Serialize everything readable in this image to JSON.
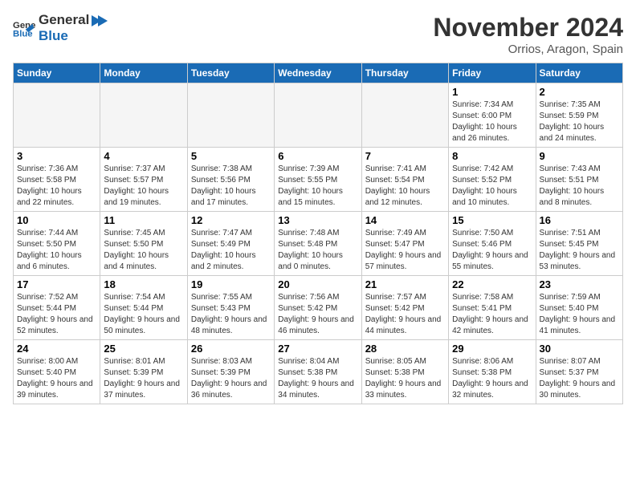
{
  "header": {
    "logo_general": "General",
    "logo_blue": "Blue",
    "month_title": "November 2024",
    "subtitle": "Orrios, Aragon, Spain"
  },
  "weekdays": [
    "Sunday",
    "Monday",
    "Tuesday",
    "Wednesday",
    "Thursday",
    "Friday",
    "Saturday"
  ],
  "weeks": [
    [
      {
        "day": "",
        "empty": true
      },
      {
        "day": "",
        "empty": true
      },
      {
        "day": "",
        "empty": true
      },
      {
        "day": "",
        "empty": true
      },
      {
        "day": "",
        "empty": true
      },
      {
        "day": "1",
        "sunrise": "Sunrise: 7:34 AM",
        "sunset": "Sunset: 6:00 PM",
        "daylight": "Daylight: 10 hours and 26 minutes."
      },
      {
        "day": "2",
        "sunrise": "Sunrise: 7:35 AM",
        "sunset": "Sunset: 5:59 PM",
        "daylight": "Daylight: 10 hours and 24 minutes."
      }
    ],
    [
      {
        "day": "3",
        "sunrise": "Sunrise: 7:36 AM",
        "sunset": "Sunset: 5:58 PM",
        "daylight": "Daylight: 10 hours and 22 minutes."
      },
      {
        "day": "4",
        "sunrise": "Sunrise: 7:37 AM",
        "sunset": "Sunset: 5:57 PM",
        "daylight": "Daylight: 10 hours and 19 minutes."
      },
      {
        "day": "5",
        "sunrise": "Sunrise: 7:38 AM",
        "sunset": "Sunset: 5:56 PM",
        "daylight": "Daylight: 10 hours and 17 minutes."
      },
      {
        "day": "6",
        "sunrise": "Sunrise: 7:39 AM",
        "sunset": "Sunset: 5:55 PM",
        "daylight": "Daylight: 10 hours and 15 minutes."
      },
      {
        "day": "7",
        "sunrise": "Sunrise: 7:41 AM",
        "sunset": "Sunset: 5:54 PM",
        "daylight": "Daylight: 10 hours and 12 minutes."
      },
      {
        "day": "8",
        "sunrise": "Sunrise: 7:42 AM",
        "sunset": "Sunset: 5:52 PM",
        "daylight": "Daylight: 10 hours and 10 minutes."
      },
      {
        "day": "9",
        "sunrise": "Sunrise: 7:43 AM",
        "sunset": "Sunset: 5:51 PM",
        "daylight": "Daylight: 10 hours and 8 minutes."
      }
    ],
    [
      {
        "day": "10",
        "sunrise": "Sunrise: 7:44 AM",
        "sunset": "Sunset: 5:50 PM",
        "daylight": "Daylight: 10 hours and 6 minutes."
      },
      {
        "day": "11",
        "sunrise": "Sunrise: 7:45 AM",
        "sunset": "Sunset: 5:50 PM",
        "daylight": "Daylight: 10 hours and 4 minutes."
      },
      {
        "day": "12",
        "sunrise": "Sunrise: 7:47 AM",
        "sunset": "Sunset: 5:49 PM",
        "daylight": "Daylight: 10 hours and 2 minutes."
      },
      {
        "day": "13",
        "sunrise": "Sunrise: 7:48 AM",
        "sunset": "Sunset: 5:48 PM",
        "daylight": "Daylight: 10 hours and 0 minutes."
      },
      {
        "day": "14",
        "sunrise": "Sunrise: 7:49 AM",
        "sunset": "Sunset: 5:47 PM",
        "daylight": "Daylight: 9 hours and 57 minutes."
      },
      {
        "day": "15",
        "sunrise": "Sunrise: 7:50 AM",
        "sunset": "Sunset: 5:46 PM",
        "daylight": "Daylight: 9 hours and 55 minutes."
      },
      {
        "day": "16",
        "sunrise": "Sunrise: 7:51 AM",
        "sunset": "Sunset: 5:45 PM",
        "daylight": "Daylight: 9 hours and 53 minutes."
      }
    ],
    [
      {
        "day": "17",
        "sunrise": "Sunrise: 7:52 AM",
        "sunset": "Sunset: 5:44 PM",
        "daylight": "Daylight: 9 hours and 52 minutes."
      },
      {
        "day": "18",
        "sunrise": "Sunrise: 7:54 AM",
        "sunset": "Sunset: 5:44 PM",
        "daylight": "Daylight: 9 hours and 50 minutes."
      },
      {
        "day": "19",
        "sunrise": "Sunrise: 7:55 AM",
        "sunset": "Sunset: 5:43 PM",
        "daylight": "Daylight: 9 hours and 48 minutes."
      },
      {
        "day": "20",
        "sunrise": "Sunrise: 7:56 AM",
        "sunset": "Sunset: 5:42 PM",
        "daylight": "Daylight: 9 hours and 46 minutes."
      },
      {
        "day": "21",
        "sunrise": "Sunrise: 7:57 AM",
        "sunset": "Sunset: 5:42 PM",
        "daylight": "Daylight: 9 hours and 44 minutes."
      },
      {
        "day": "22",
        "sunrise": "Sunrise: 7:58 AM",
        "sunset": "Sunset: 5:41 PM",
        "daylight": "Daylight: 9 hours and 42 minutes."
      },
      {
        "day": "23",
        "sunrise": "Sunrise: 7:59 AM",
        "sunset": "Sunset: 5:40 PM",
        "daylight": "Daylight: 9 hours and 41 minutes."
      }
    ],
    [
      {
        "day": "24",
        "sunrise": "Sunrise: 8:00 AM",
        "sunset": "Sunset: 5:40 PM",
        "daylight": "Daylight: 9 hours and 39 minutes."
      },
      {
        "day": "25",
        "sunrise": "Sunrise: 8:01 AM",
        "sunset": "Sunset: 5:39 PM",
        "daylight": "Daylight: 9 hours and 37 minutes."
      },
      {
        "day": "26",
        "sunrise": "Sunrise: 8:03 AM",
        "sunset": "Sunset: 5:39 PM",
        "daylight": "Daylight: 9 hours and 36 minutes."
      },
      {
        "day": "27",
        "sunrise": "Sunrise: 8:04 AM",
        "sunset": "Sunset: 5:38 PM",
        "daylight": "Daylight: 9 hours and 34 minutes."
      },
      {
        "day": "28",
        "sunrise": "Sunrise: 8:05 AM",
        "sunset": "Sunset: 5:38 PM",
        "daylight": "Daylight: 9 hours and 33 minutes."
      },
      {
        "day": "29",
        "sunrise": "Sunrise: 8:06 AM",
        "sunset": "Sunset: 5:38 PM",
        "daylight": "Daylight: 9 hours and 32 minutes."
      },
      {
        "day": "30",
        "sunrise": "Sunrise: 8:07 AM",
        "sunset": "Sunset: 5:37 PM",
        "daylight": "Daylight: 9 hours and 30 minutes."
      }
    ]
  ]
}
